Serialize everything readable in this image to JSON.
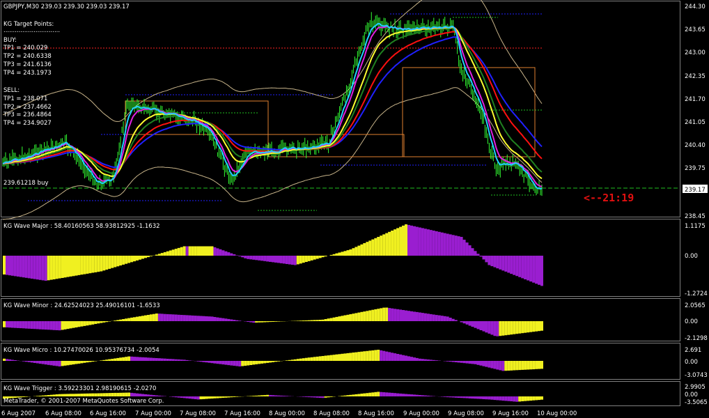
{
  "colors": {
    "background": "#000000",
    "border": "#808080",
    "candle": "#33ff33",
    "grid_text": "#ffffff",
    "ma_blue": "#2020ff",
    "ma_red": "#ff1010",
    "ma_yellow": "#ffff30",
    "ma_green": "#208020",
    "ma_cyan": "#20d0ff",
    "ma_magenta": "#e020e0",
    "envelope": "#c8b48a",
    "box_orange": "#e08030",
    "level_blue": "#2020ff",
    "level_red": "#ff2020",
    "level_green": "#20c020",
    "hist_purple": "#9a1ed0",
    "hist_yellow": "#f0f020",
    "timer": "#e01010"
  },
  "main": {
    "title": "GBPJPY,M30  239.03 239.30 239.03 239.17",
    "target_header": "KG Target Points:",
    "target_divider": "..............................",
    "buy_label": "BUY:",
    "buy_targets": [
      "TP1 = 240.029",
      "TP2 = 240.6338",
      "TP3 = 241.6136",
      "TP4 = 243.1973"
    ],
    "sell_label": "SELL:",
    "sell_targets": [
      "TP1 = 238.071",
      "TP2 = 237.4662",
      "TP3 = 236.4864",
      "TP4 = 234.9027"
    ],
    "entry_label": "239.61218 buy",
    "timer": "<--21:19",
    "price_tag": "239.17",
    "y_ticks": [
      "244.30",
      "243.65",
      "243.00",
      "242.35",
      "241.70",
      "241.05",
      "240.40",
      "239.75",
      "238.45"
    ]
  },
  "panels": [
    {
      "title": "KG Wave Major : 58.40160563 58.93812925 -1.1632",
      "ticks": [
        "1.1175",
        "0.00",
        "-1.2724"
      ]
    },
    {
      "title": "KG Wave Minor : 24.62524023 25.49016101 -1.6533",
      "ticks": [
        "2.0565",
        "0.00",
        "-2.1298"
      ]
    },
    {
      "title": "KG Wave Micro : 10.27470026 10.95376734 -2.0054",
      "ticks": [
        "2.691",
        "0.00",
        "-3.0743"
      ]
    },
    {
      "title": "KG Wave Trigger : 3.59223301 2.98190615 -2.0270",
      "ticks": [
        "2.9905",
        "0.00",
        "-3.5065"
      ]
    }
  ],
  "copyright": "MetaTrader, © 2001-2007 MetaQuotes Software Corp.",
  "x_labels": [
    "6 Aug 2007",
    "6 Aug 08:00",
    "6 Aug 16:00",
    "7 Aug 00:00",
    "7 Aug 08:00",
    "7 Aug 16:00",
    "8 Aug 00:00",
    "8 Aug 08:00",
    "8 Aug 16:00",
    "9 Aug 00:00",
    "9 Aug 08:00",
    "9 Aug 16:00",
    "10 Aug 00:00"
  ]
}
